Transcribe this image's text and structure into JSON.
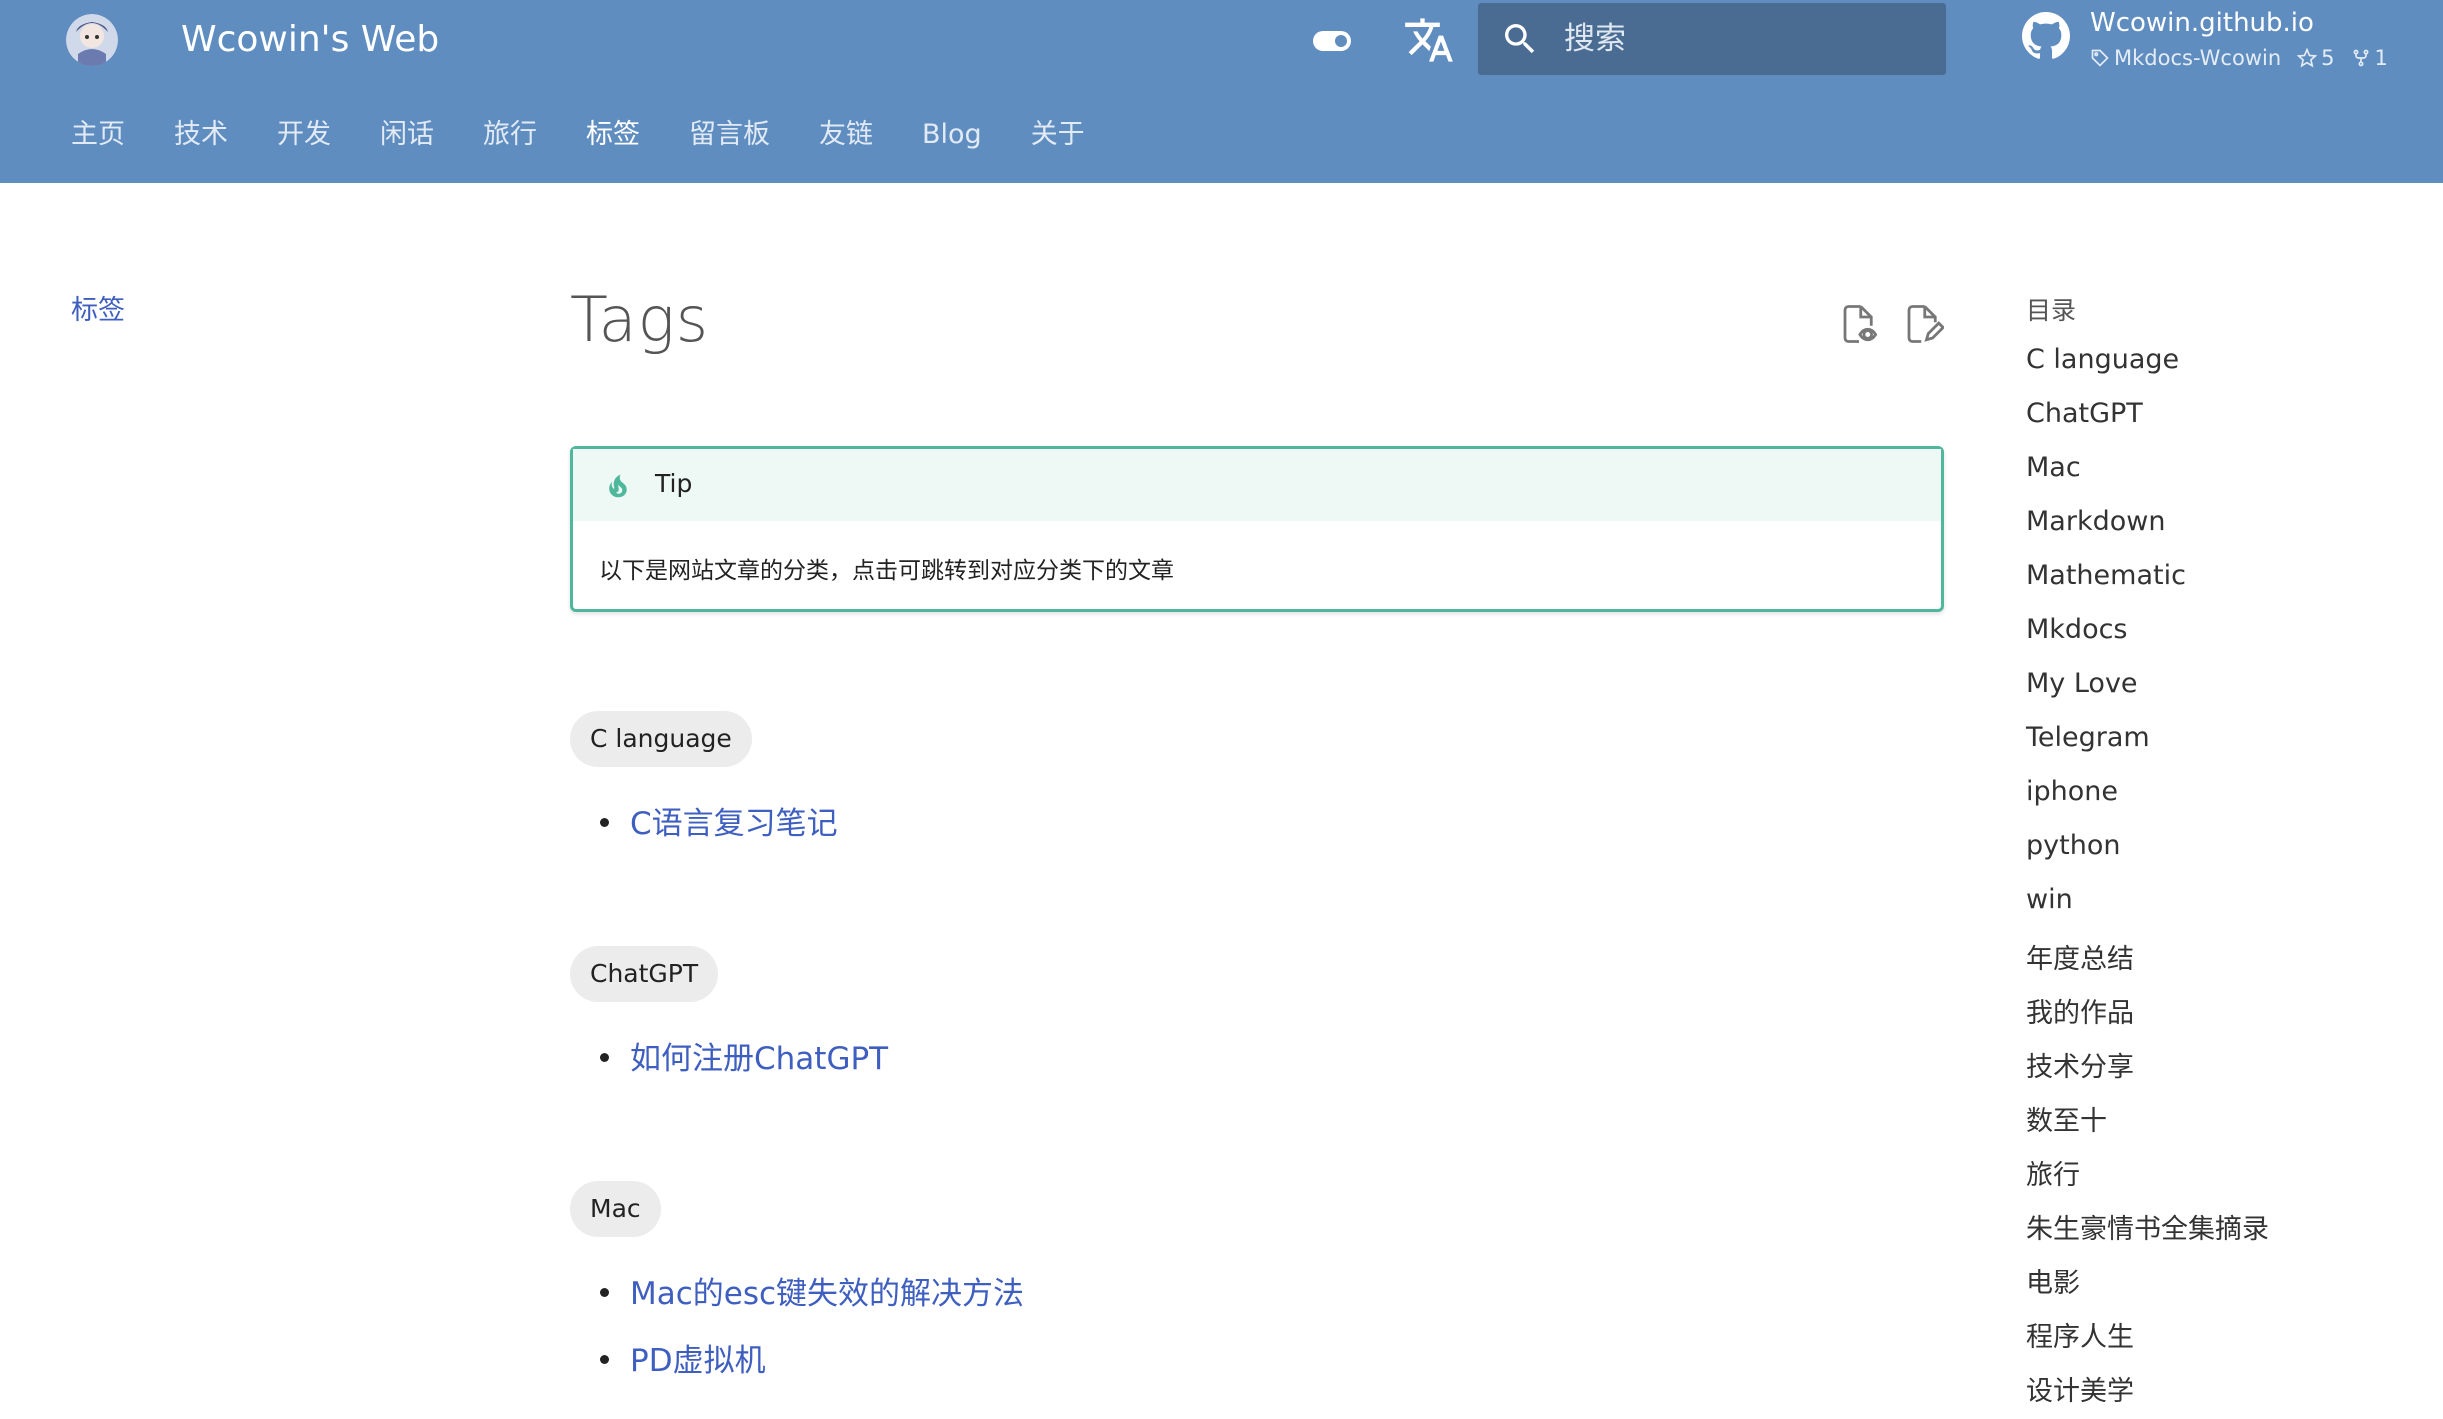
{
  "header": {
    "site_title": "Wcowin's Web",
    "search_placeholder": "搜索",
    "repo": {
      "name": "Wcowin.github.io",
      "tag": "Mkdocs-Wcowin",
      "stars": "5",
      "forks": "1"
    },
    "tabs": [
      {
        "label": "主页"
      },
      {
        "label": "技术"
      },
      {
        "label": "开发"
      },
      {
        "label": "闲话"
      },
      {
        "label": "旅行"
      },
      {
        "label": "标签"
      },
      {
        "label": "留言板"
      },
      {
        "label": "友链"
      },
      {
        "label": "Blog"
      },
      {
        "label": "关于"
      }
    ]
  },
  "left_nav": {
    "item": "标签"
  },
  "main": {
    "title": "Tags",
    "tip": {
      "title": "Tip",
      "body": "以下是网站文章的分类，点击可跳转到对应分类下的文章"
    },
    "sections": [
      {
        "tag": "C language",
        "items": [
          "C语言复习笔记"
        ]
      },
      {
        "tag": "ChatGPT",
        "items": [
          "如何注册ChatGPT"
        ]
      },
      {
        "tag": "Mac",
        "items": [
          "Mac的esc键失效的解决方法",
          "PD虚拟机"
        ]
      }
    ]
  },
  "toc": {
    "title": "目录",
    "items": [
      "C language",
      "ChatGPT",
      "Mac",
      "Markdown",
      "Mathematic",
      "Mkdocs",
      "My Love",
      "Telegram",
      "iphone",
      "python",
      "win",
      "年度总结",
      "我的作品",
      "技术分享",
      "数至十",
      "旅行",
      "朱生豪情书全集摘录",
      "电影",
      "程序人生",
      "设计美学"
    ]
  },
  "colors": {
    "header_bg": "#5f8dc0",
    "search_bg": "#4a6c93",
    "link": "#3f5fc0",
    "tip_border": "#4fb79c",
    "tip_bg": "#eef8f5"
  },
  "icons": [
    "logo-avatar",
    "toggle-icon",
    "translate-icon",
    "search-icon",
    "github-icon",
    "tag-icon",
    "star-icon",
    "fork-icon",
    "view-source-icon",
    "edit-icon",
    "flame-icon"
  ]
}
